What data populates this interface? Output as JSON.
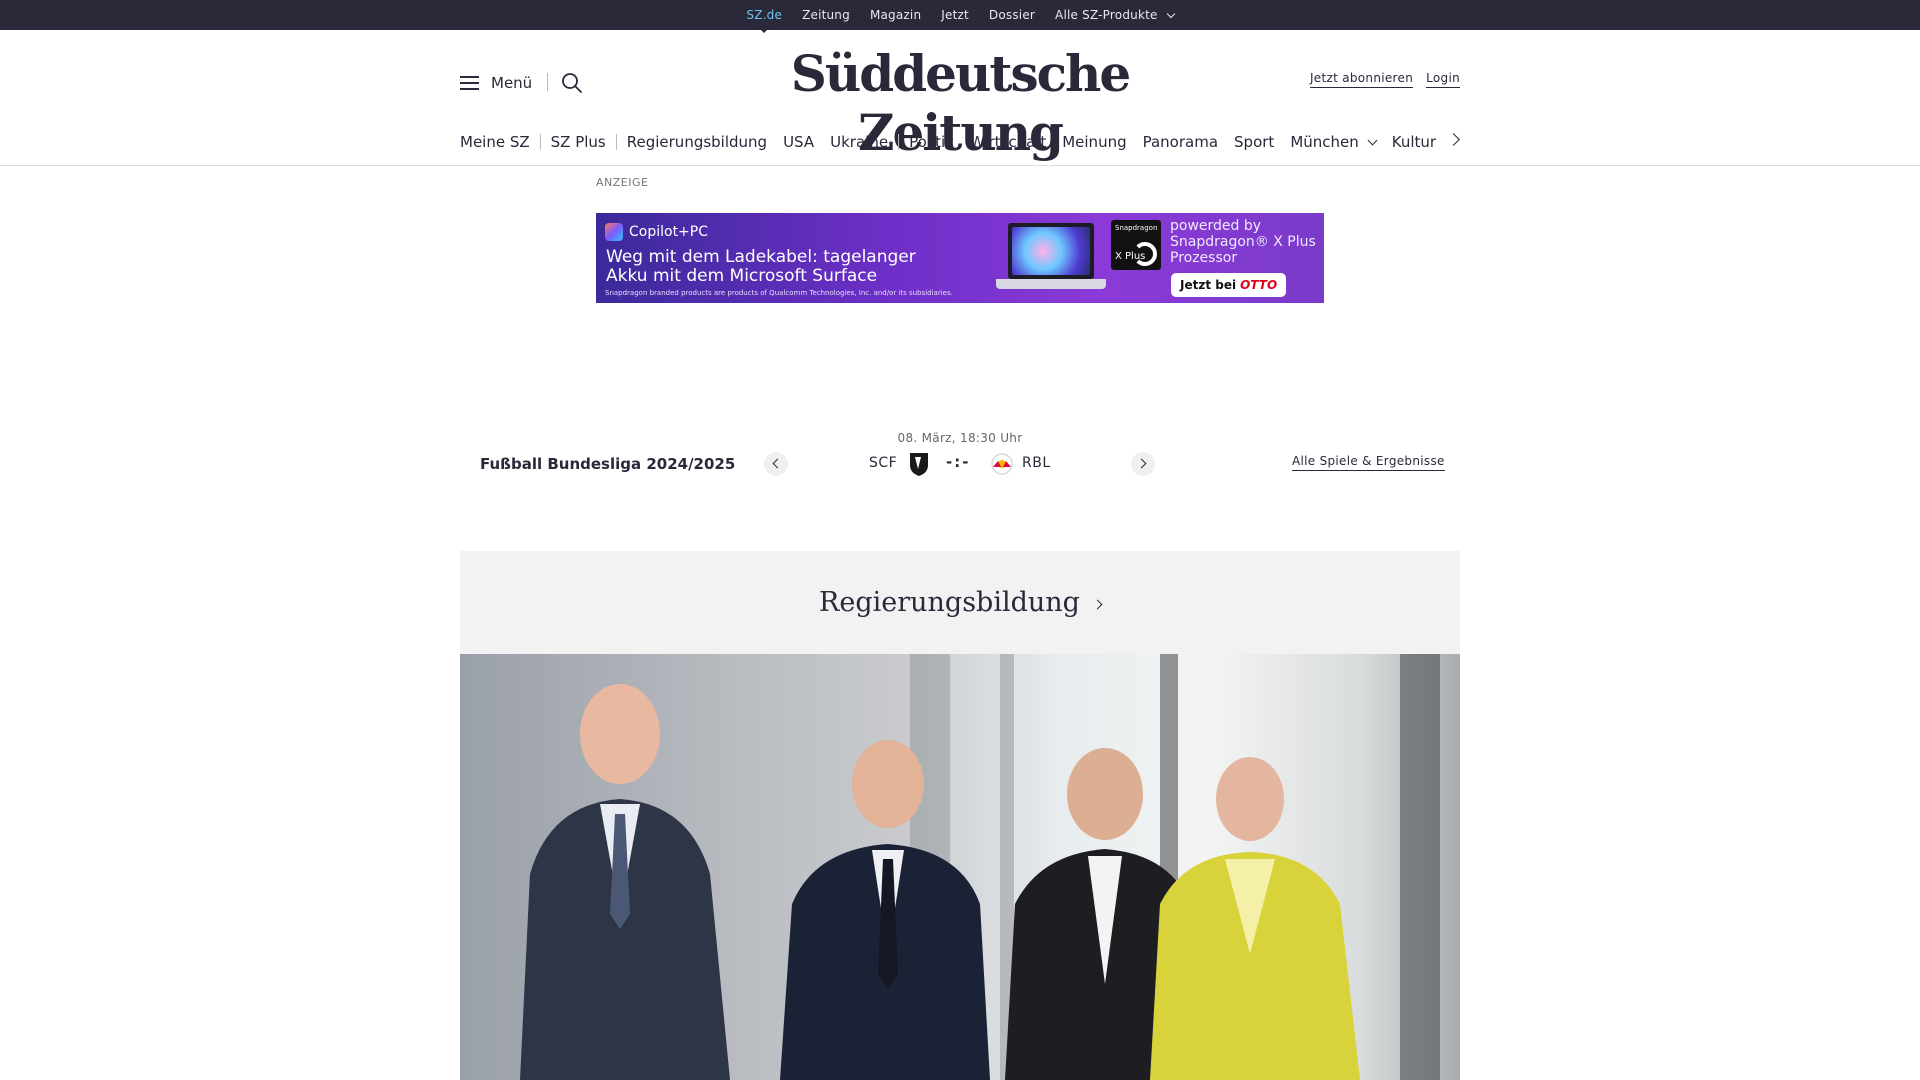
{
  "topbar": {
    "items": [
      "SZ.de",
      "Zeitung",
      "Magazin",
      "Jetzt",
      "Dossier",
      "Alle SZ-Produkte"
    ]
  },
  "header": {
    "menu_label": "Menü",
    "logo": "Süddeutsche Zeitung",
    "subscribe": "Jetzt abonnieren",
    "login": "Login"
  },
  "nav": {
    "items": [
      "Meine SZ",
      "SZ Plus",
      "Regierungsbildung",
      "USA",
      "Ukraine",
      "Politik",
      "Wirtschaft",
      "Meinung",
      "Panorama",
      "Sport",
      "München",
      "Kultur"
    ]
  },
  "ad": {
    "label": "ANZEIGE",
    "brand": "Copilot+PC",
    "headline": "Weg mit dem Ladekabel: tagelanger Akku mit dem Microsoft Surface",
    "fine_print": "Snapdragon branded products are products of Qualcomm Technologies, Inc. and/or its subsidiaries.",
    "chip_label": "Snapdragon",
    "chip_mark": "X Plus",
    "powered": "powerded by Snapdragon® X Plus Prozessor",
    "cta": "Jetzt bei",
    "cta_brand": "OTTO"
  },
  "score": {
    "league": "Fußball Bundesliga 2024/2025",
    "date": "08. März, 18:30 Uhr",
    "home": "SCF",
    "away": "RBL",
    "result": "-:-",
    "all_games": "Alle Spiele & Ergebnisse"
  },
  "section": {
    "title": "Regierungsbildung"
  }
}
